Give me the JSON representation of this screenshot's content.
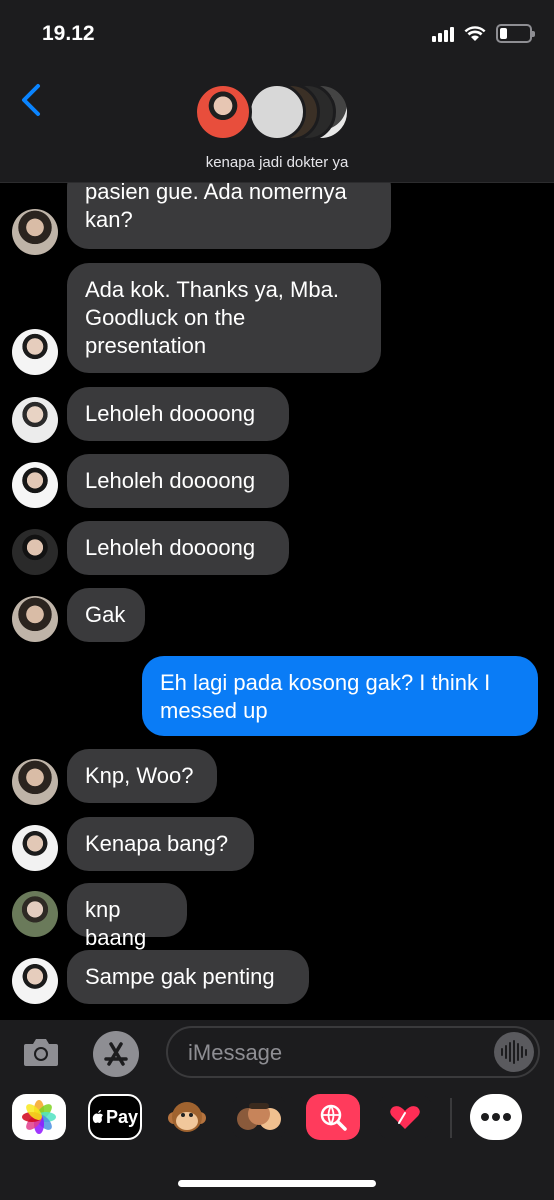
{
  "status": {
    "time": "19.12"
  },
  "header": {
    "group_name": "kenapa jadi dokter ya"
  },
  "messages": [
    {
      "text": "pasien gue. Ada nomernya\nkan?",
      "sender": "them"
    },
    {
      "text": "Ada kok. Thanks ya, Mba.\nGoodluck on the\npresentation",
      "sender": "them"
    },
    {
      "text": "Leholeh doooong",
      "sender": "them"
    },
    {
      "text": "Leholeh doooong",
      "sender": "them"
    },
    {
      "text": "Leholeh doooong",
      "sender": "them"
    },
    {
      "text": "Gak",
      "sender": "them"
    },
    {
      "text": "Eh lagi pada kosong gak? I think I\nmessed up",
      "sender": "me"
    },
    {
      "text": "Knp, Woo?",
      "sender": "them"
    },
    {
      "text": "Kenapa bang?",
      "sender": "them"
    },
    {
      "text": "knp baang",
      "sender": "them"
    },
    {
      "text": "Sampe gak penting",
      "sender": "them"
    }
  ],
  "input": {
    "placeholder": "iMessage"
  },
  "apps": [
    {
      "name": "photos-app-icon"
    },
    {
      "name": "apple-pay-app-icon",
      "label": "Pay"
    },
    {
      "name": "animoji-app-icon"
    },
    {
      "name": "memoji-app-icon"
    },
    {
      "name": "web-search-app-icon"
    },
    {
      "name": "digital-touch-app-icon"
    },
    {
      "name": "more-apps-icon"
    }
  ],
  "colors": {
    "incoming_bubble": "#3a3a3c",
    "outgoing_bubble": "#0a7cf6",
    "accent": "#0a84ff"
  }
}
